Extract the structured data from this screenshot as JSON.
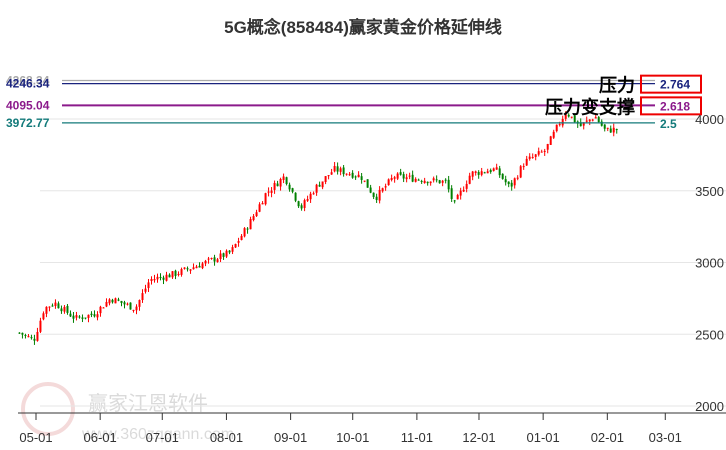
{
  "chart_data": {
    "type": "candlestick",
    "title": "5G概念(858484)赢家黄金价格延伸线",
    "ylim": [
      2000,
      4300
    ],
    "y_ticks": [
      2000,
      2500,
      3000,
      3500,
      4000
    ],
    "x_ticks": [
      {
        "label": "05-01",
        "day": 0
      },
      {
        "label": "06-01",
        "day": 31
      },
      {
        "label": "07-01",
        "day": 61
      },
      {
        "label": "08-01",
        "day": 92
      },
      {
        "label": "09-01",
        "day": 123
      },
      {
        "label": "10-01",
        "day": 153
      },
      {
        "label": "11-01",
        "day": 184
      },
      {
        "label": "12-01",
        "day": 214
      },
      {
        "label": "01-01",
        "day": 245
      },
      {
        "label": "02-01",
        "day": 276
      },
      {
        "label": "03-01",
        "day": 304
      }
    ],
    "price_trend_days": [
      -8,
      -1,
      4,
      9,
      19,
      28,
      36,
      48,
      55,
      67,
      82,
      94,
      103,
      111,
      120,
      128,
      135,
      144,
      157,
      164,
      173,
      186,
      198,
      202,
      210,
      222,
      229,
      236,
      246,
      252,
      256,
      263,
      270,
      275,
      281
    ],
    "price_trend_values": [
      2510,
      2460,
      2680,
      2720,
      2610,
      2640,
      2750,
      2680,
      2880,
      2920,
      3000,
      3070,
      3270,
      3480,
      3600,
      3380,
      3520,
      3650,
      3600,
      3450,
      3600,
      3580,
      3560,
      3400,
      3620,
      3650,
      3520,
      3700,
      3780,
      3950,
      4050,
      3950,
      4020,
      3920,
      3930
    ],
    "levels": [
      {
        "price": 4268.34,
        "label": "4268.34",
        "ratio": "",
        "color": "#aaaaaa"
      },
      {
        "price": 4246.34,
        "label": "4246.34",
        "ratio": "2.764",
        "color": "#1a237e",
        "note": "压力"
      },
      {
        "price": 4095.04,
        "label": "4095.04",
        "ratio": "2.618",
        "color": "#8b1a8b",
        "note": "压力变支撑"
      },
      {
        "price": 3972.77,
        "label": "3972.77",
        "ratio": "2.5",
        "color": "#137a7a"
      }
    ],
    "up_color": "#ff0000",
    "down_color": "#008000"
  },
  "watermark": {
    "name": "赢家江恩软件",
    "url": "www.360zqgann.com"
  }
}
